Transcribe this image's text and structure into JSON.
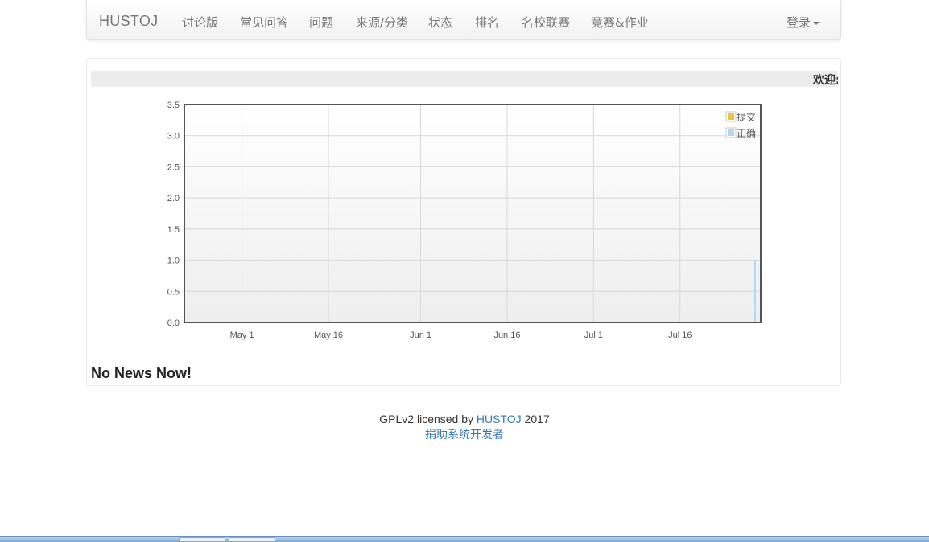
{
  "navbar": {
    "brand": "HUSTOJ",
    "items": [
      {
        "label": "讨论版"
      },
      {
        "label": "常见问答"
      },
      {
        "label": "问题"
      },
      {
        "label": "来源/分类"
      },
      {
        "label": "状态"
      },
      {
        "label": "排名"
      },
      {
        "label": "名校联赛"
      },
      {
        "label": "竞赛&作业"
      }
    ],
    "login": "登录"
  },
  "marquee": {
    "text": "欢迎:"
  },
  "chart_data": {
    "type": "line",
    "x_ticks": [
      "May 1",
      "May 16",
      "Jun 1",
      "Jun 16",
      "Jul 1",
      "Jul 16"
    ],
    "y_ticks": [
      "0.0",
      "0.5",
      "1.0",
      "1.5",
      "2.0",
      "2.5",
      "3.0",
      "3.5"
    ],
    "ylim": [
      0,
      3.5
    ],
    "xlim": [
      "Apr 21",
      "Jul 30"
    ],
    "grid": true,
    "legend_position": "top-right",
    "series": [
      {
        "name": "提交",
        "color": "#edc240",
        "points": [
          {
            "x": "Jul 29",
            "y": 0
          }
        ]
      },
      {
        "name": "正确",
        "color": "#afd8f8",
        "points": [
          {
            "x": "Jul 29",
            "y": 1
          }
        ]
      }
    ]
  },
  "news": {
    "text": "No News Now!"
  },
  "footer": {
    "license_prefix": "GPLv2 licensed by",
    "license_link": "HUSTOJ",
    "year": "2017",
    "donate": "捐助系统开发者"
  }
}
